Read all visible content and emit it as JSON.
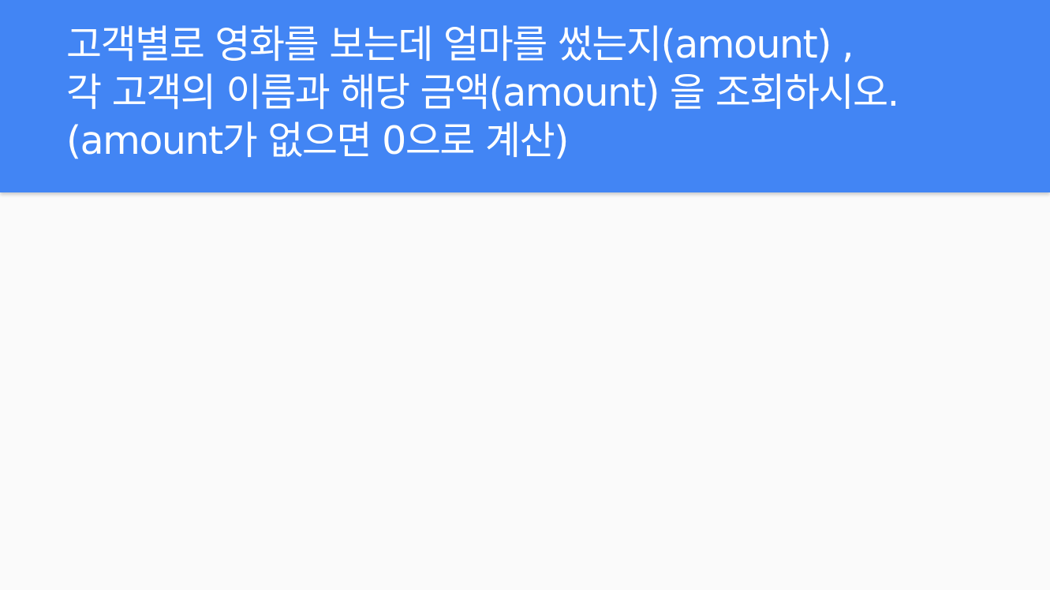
{
  "slide": {
    "title_lines": [
      "고객별로 영화를 보는데 얼마를 썼는지(amount) ,",
      "각 고객의 이름과 해당 금액(amount) 을 조회하시오.",
      "(amount가 없으면 0으로 계산)"
    ]
  },
  "colors": {
    "header_background": "#4285f4",
    "title_text": "#ffffff",
    "page_background": "#fafafa"
  }
}
